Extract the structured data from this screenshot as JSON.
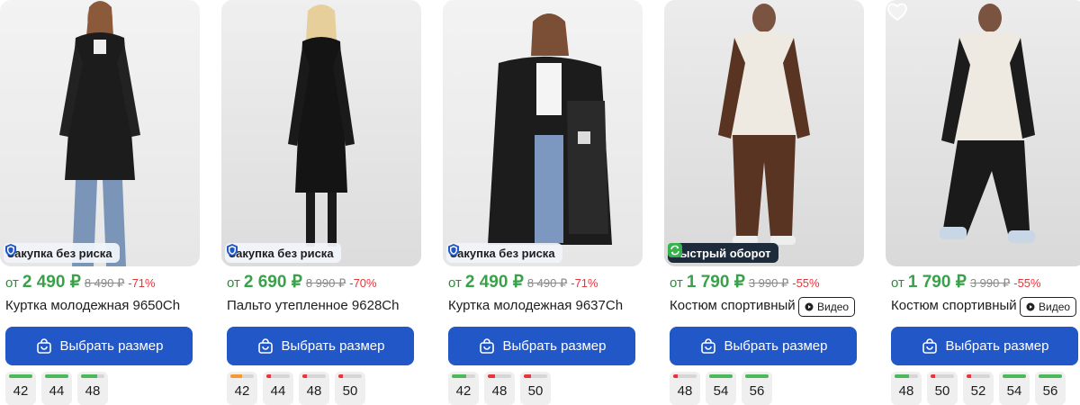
{
  "colors": {
    "price_green": "#3aa14a",
    "discount_red": "#e8343b",
    "button_blue": "#2257c7",
    "stock_high": "#4bb85a",
    "stock_mid": "#f39a34",
    "stock_low": "#e8343b"
  },
  "cards": [
    {
      "badge": "Закупка без риска",
      "badge_icon": "shield-icon",
      "price_from": "от",
      "price": "2 490 ₽",
      "old_price": "8 490 ₽",
      "discount": "-71%",
      "title": "Куртка молодежная 9650Ch",
      "button": "Выбрать размер",
      "sizes": [
        {
          "label": "42",
          "stock": 1.0,
          "level": "high"
        },
        {
          "label": "44",
          "stock": 1.0,
          "level": "high"
        },
        {
          "label": "48",
          "stock": 0.7,
          "level": "high"
        }
      ]
    },
    {
      "badge": "Закупка без риска",
      "badge_icon": "shield-icon",
      "price_from": "от",
      "price": "2 690 ₽",
      "old_price": "8 990 ₽",
      "discount": "-70%",
      "title": "Пальто утепленное 9628Ch",
      "button": "Выбрать размер",
      "sizes": [
        {
          "label": "42",
          "stock": 0.5,
          "level": "mid"
        },
        {
          "label": "44",
          "stock": 0.2,
          "level": "low"
        },
        {
          "label": "48",
          "stock": 0.2,
          "level": "low"
        },
        {
          "label": "50",
          "stock": 0.2,
          "level": "low"
        }
      ]
    },
    {
      "badge": "Закупка без риска",
      "badge_icon": "shield-icon",
      "price_from": "от",
      "price": "2 490 ₽",
      "old_price": "8 490 ₽",
      "discount": "-71%",
      "title": "Куртка молодежная 9637Ch",
      "button": "Выбрать размер",
      "sizes": [
        {
          "label": "42",
          "stock": 0.6,
          "level": "high"
        },
        {
          "label": "48",
          "stock": 0.3,
          "level": "low"
        },
        {
          "label": "50",
          "stock": 0.3,
          "level": "low"
        }
      ]
    },
    {
      "badge": "Быстрый оборот",
      "badge_icon": "refresh-icon",
      "price_from": "от",
      "price": "1 790 ₽",
      "old_price": "3 990 ₽",
      "discount": "-55%",
      "title": "Костюм спортивный",
      "video": "Видео",
      "button": "Выбрать размер",
      "sizes": [
        {
          "label": "48",
          "stock": 0.2,
          "level": "low"
        },
        {
          "label": "54",
          "stock": 1.0,
          "level": "high"
        },
        {
          "label": "56",
          "stock": 1.0,
          "level": "high"
        }
      ]
    },
    {
      "price_from": "от",
      "price": "1 790 ₽",
      "old_price": "3 990 ₽",
      "discount": "-55%",
      "title": "Костюм спортивный",
      "video": "Видео",
      "button": "Выбрать размер",
      "sizes": [
        {
          "label": "48",
          "stock": 0.6,
          "level": "high"
        },
        {
          "label": "50",
          "stock": 0.2,
          "level": "low"
        },
        {
          "label": "52",
          "stock": 0.2,
          "level": "low"
        },
        {
          "label": "54",
          "stock": 1.0,
          "level": "high"
        },
        {
          "label": "56",
          "stock": 1.0,
          "level": "high"
        }
      ]
    }
  ]
}
